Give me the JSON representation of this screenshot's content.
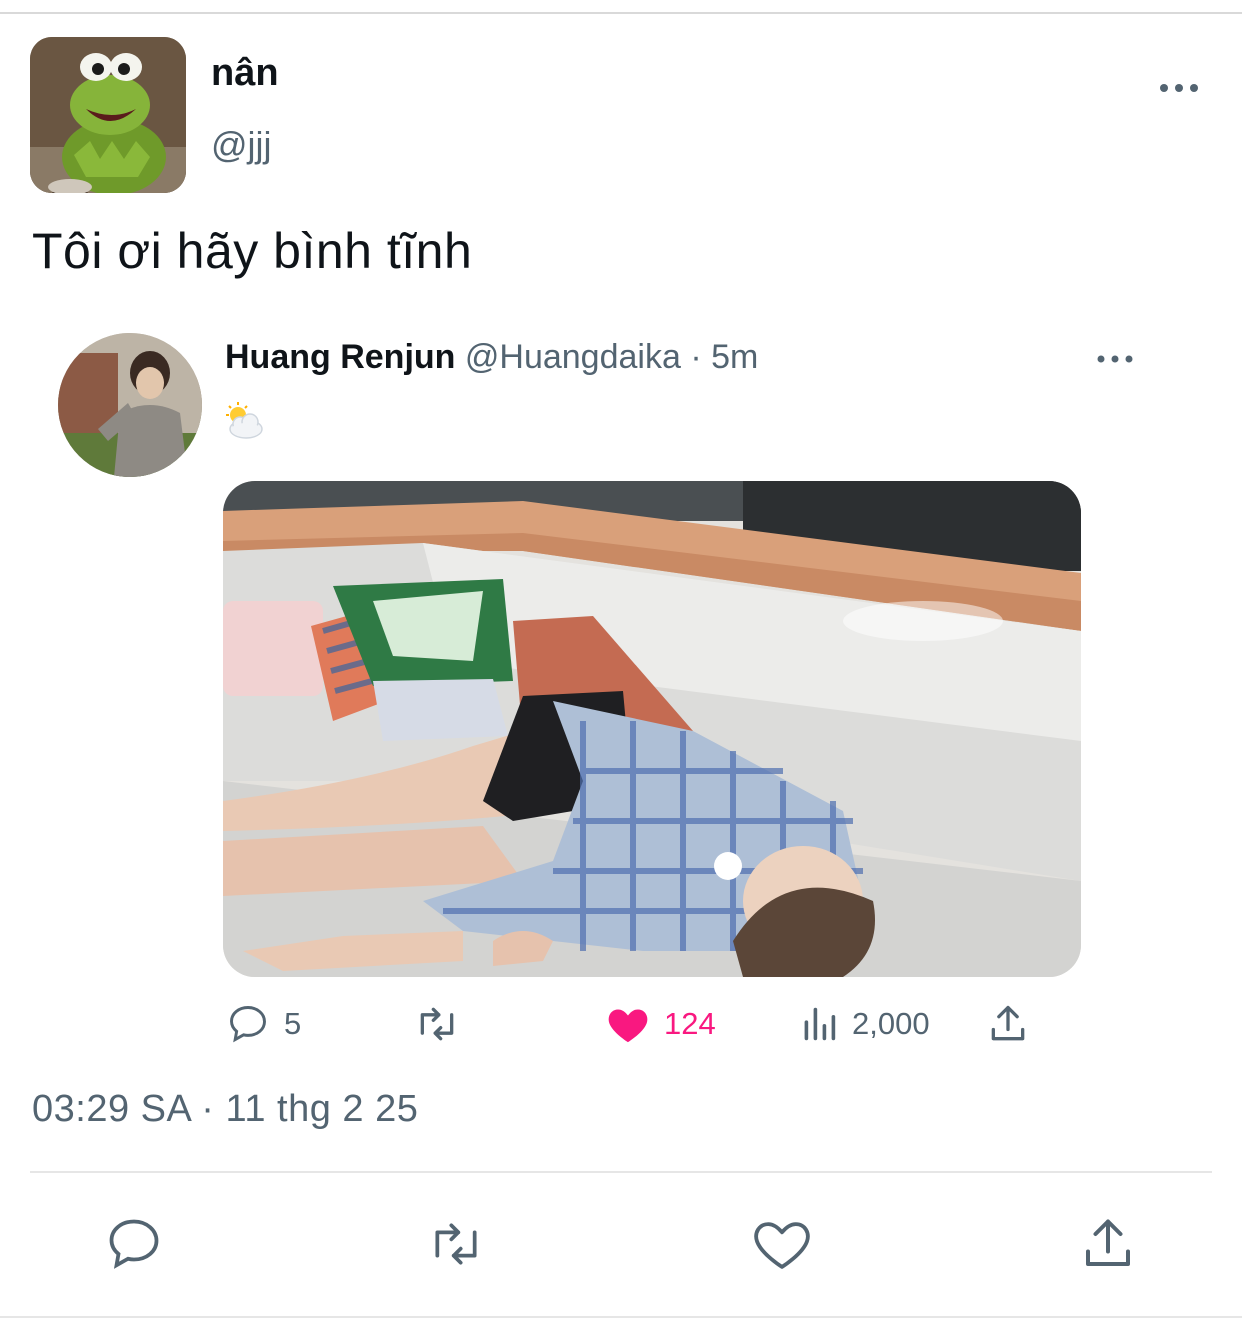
{
  "tweet": {
    "author": {
      "name": "nân",
      "handle": "@jjj",
      "avatar_icon": "kermit-avatar"
    },
    "text": "Tôi ơi hãy bình tĩnh",
    "timestamp": "03:29 SA · 11 thg 2 25",
    "more_icon": "more-horizontal-icon"
  },
  "quoted": {
    "author_name": "Huang Renjun",
    "handle": "@Huangdaika",
    "separator": " · ",
    "time": "5m",
    "emoji_icon": "sun-behind-cloud-icon",
    "actions": {
      "replies": "5",
      "likes": "124",
      "views": "2,000"
    }
  },
  "bottom_actions": [
    "reply-icon",
    "retweet-icon",
    "like-icon",
    "share-icon"
  ],
  "colors": {
    "text": "#0f1419",
    "secondary": "#536471",
    "like": "#f91880",
    "divider": "#e6e6e6"
  }
}
